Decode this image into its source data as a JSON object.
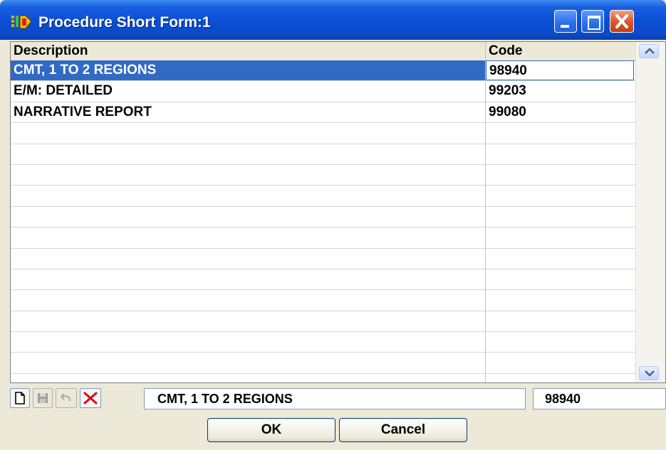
{
  "window": {
    "title": "Procedure Short Form:1",
    "icon": "app-icon",
    "controls": [
      "minimize-icon",
      "maximize-icon",
      "close-icon"
    ]
  },
  "grid": {
    "columns": [
      "Description",
      "Code"
    ],
    "rows": [
      {
        "description": "CMT, 1 TO 2 REGIONS",
        "code": "98940",
        "selected": true
      },
      {
        "description": "E/M: DETAILED",
        "code": "99203",
        "selected": false
      },
      {
        "description": "NARRATIVE REPORT",
        "code": "99080",
        "selected": false
      },
      {
        "description": "",
        "code": "",
        "selected": false
      },
      {
        "description": "",
        "code": "",
        "selected": false
      },
      {
        "description": "",
        "code": "",
        "selected": false
      },
      {
        "description": "",
        "code": "",
        "selected": false
      },
      {
        "description": "",
        "code": "",
        "selected": false
      },
      {
        "description": "",
        "code": "",
        "selected": false
      },
      {
        "description": "",
        "code": "",
        "selected": false
      },
      {
        "description": "",
        "code": "",
        "selected": false
      },
      {
        "description": "",
        "code": "",
        "selected": false
      },
      {
        "description": "",
        "code": "",
        "selected": false
      },
      {
        "description": "",
        "code": "",
        "selected": false
      },
      {
        "description": "",
        "code": "",
        "selected": false
      },
      {
        "description": "",
        "code": "",
        "selected": false
      }
    ]
  },
  "editor": {
    "tools": [
      "new-icon",
      "save-icon",
      "undo-icon",
      "delete-icon"
    ],
    "description_value": "CMT, 1 TO 2 REGIONS",
    "code_value": "98940"
  },
  "buttons": {
    "ok": "OK",
    "cancel": "Cancel"
  },
  "colors": {
    "titlebar": "#0a4fd6",
    "selection": "#316ac5",
    "close": "#d8552a",
    "delete": "#e0001a"
  }
}
